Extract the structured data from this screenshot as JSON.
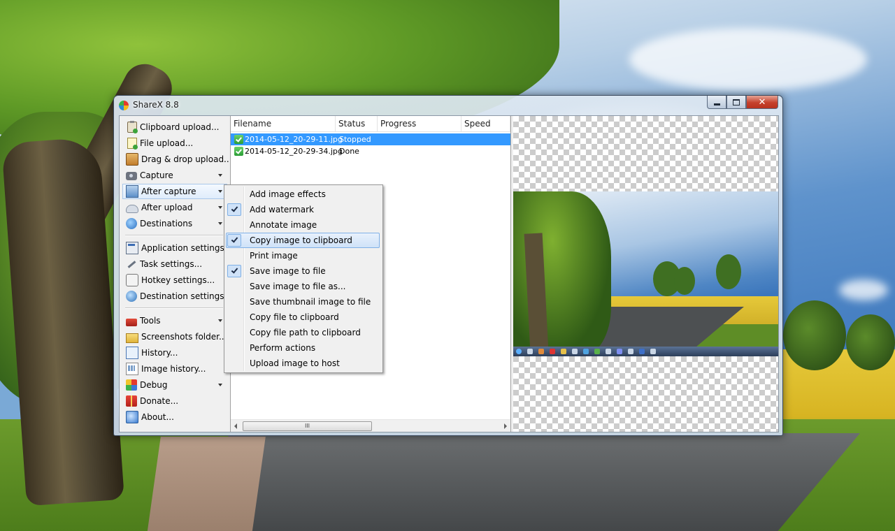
{
  "window": {
    "title": "ShareX 8.8"
  },
  "main_menu": [
    {
      "label": "Clipboard upload...",
      "icon": "clipboard-upload-icon"
    },
    {
      "label": "File upload...",
      "icon": "file-upload-icon"
    },
    {
      "label": "Drag & drop upload...",
      "icon": "drag-drop-icon"
    },
    {
      "label": "Capture",
      "icon": "camera-icon",
      "submenu": true
    },
    {
      "label": "After capture",
      "icon": "after-capture-icon",
      "submenu": true,
      "open": true
    },
    {
      "label": "After upload",
      "icon": "cloud-icon",
      "submenu": true
    },
    {
      "label": "Destinations",
      "icon": "destinations-icon",
      "submenu": true
    },
    {
      "label": "Application settings...",
      "icon": "app-settings-icon"
    },
    {
      "label": "Task settings...",
      "icon": "wrench-icon"
    },
    {
      "label": "Hotkey settings...",
      "icon": "keyboard-icon"
    },
    {
      "label": "Destination settings...",
      "icon": "globe-icon"
    },
    {
      "label": "Tools",
      "icon": "toolbox-icon",
      "submenu": true
    },
    {
      "label": "Screenshots folder...",
      "icon": "folder-icon"
    },
    {
      "label": "History...",
      "icon": "history-icon"
    },
    {
      "label": "Image history...",
      "icon": "image-history-icon"
    },
    {
      "label": "Debug",
      "icon": "debug-icon",
      "submenu": true
    },
    {
      "label": "Donate...",
      "icon": "gift-icon"
    },
    {
      "label": "About...",
      "icon": "about-icon"
    }
  ],
  "task_list": {
    "columns": [
      "Filename",
      "Status",
      "Progress",
      "Speed"
    ],
    "rows": [
      {
        "filename": "2014-05-12_20-29-11.jpg",
        "status": "Stopped",
        "selected": true
      },
      {
        "filename": "2014-05-12_20-29-34.jpg",
        "status": "Done",
        "selected": false
      }
    ],
    "scroll_thumb_glyph": "III"
  },
  "after_capture_menu": [
    {
      "label": "Add image effects",
      "checked": false
    },
    {
      "label": "Add watermark",
      "checked": true
    },
    {
      "label": "Annotate image",
      "checked": false
    },
    {
      "label": "Copy image to clipboard",
      "checked": true,
      "highlighted": true
    },
    {
      "label": "Print image",
      "checked": false
    },
    {
      "label": "Save image to file",
      "checked": true
    },
    {
      "label": "Save image to file as...",
      "checked": false
    },
    {
      "label": "Save thumbnail image to file",
      "checked": false
    },
    {
      "label": "Copy file to clipboard",
      "checked": false
    },
    {
      "label": "Copy file path to clipboard",
      "checked": false
    },
    {
      "label": "Perform actions",
      "checked": false
    },
    {
      "label": "Upload image to host",
      "checked": false
    }
  ],
  "colors": {
    "selection": "#3399ff",
    "menu_highlight": "#cfe2f8",
    "close_button": "#c5402c"
  }
}
